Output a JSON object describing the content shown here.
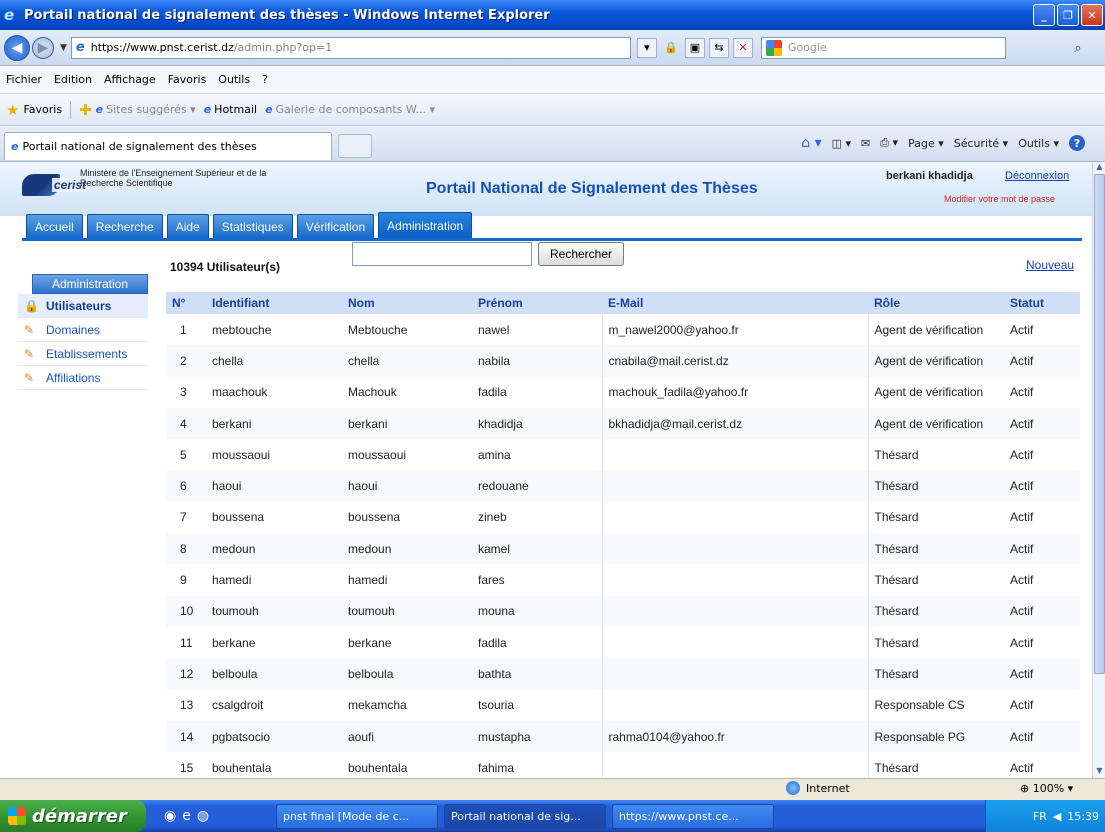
{
  "window": {
    "title": "Portail national de signalement des thèses - Windows Internet Explorer"
  },
  "address": {
    "url_host": "https://www.pnst.cerist.dz",
    "url_path": "/admin.php?op=1",
    "search_placeholder": "Google"
  },
  "menu": [
    "Fichier",
    "Edition",
    "Affichage",
    "Favoris",
    "Outils",
    "?"
  ],
  "favorites": {
    "label": "Favoris",
    "items": [
      "Sites suggérés ▾",
      "Hotmail",
      "Galerie de composants W... ▾"
    ]
  },
  "tab": {
    "title": "Portail national de signalement des thèses"
  },
  "commands": {
    "page": "Page ▾",
    "security": "Sécurité ▾",
    "tools": "Outils ▾"
  },
  "site": {
    "ministry": "Ministère de l'Enseignement Supérieur et de la Recherche Scientifique",
    "logo_word": "cerist",
    "title": "Portail National de Signalement des Thèses",
    "user": "berkani khadidja",
    "logout": "Déconnexion",
    "change_password": "Modifier votre mot de passe"
  },
  "nav": [
    "Accueil",
    "Recherche",
    "Aide",
    "Statistiques",
    "Vérification",
    "Administration"
  ],
  "sidebar": {
    "title": "Administration",
    "items": [
      "Utilisateurs",
      "Domaines",
      "Etablissements",
      "Affiliations"
    ]
  },
  "users": {
    "count_label": "10394 Utilisateur(s)",
    "search_button": "Rechercher",
    "new_link": "Nouveau",
    "columns": [
      "N°",
      "Identifiant",
      "Nom",
      "Prénom",
      "E-Mail",
      "Rôle",
      "Statut"
    ],
    "rows": [
      [
        "1",
        "mebtouche",
        "Mebtouche",
        "nawel",
        "m_nawel2000@yahoo.fr",
        "Agent de vérification",
        "Actif"
      ],
      [
        "2",
        "chella",
        "chella",
        "nabila",
        "cnabila@mail.cerist.dz",
        "Agent de vérification",
        "Actif"
      ],
      [
        "3",
        "maachouk",
        "Machouk",
        "fadila",
        "machouk_fadila@yahoo.fr",
        "Agent de vérification",
        "Actif"
      ],
      [
        "4",
        "berkani",
        "berkani",
        "khadidja",
        "bkhadidja@mail.cerist.dz",
        "Agent de vérification",
        "Actif"
      ],
      [
        "5",
        "moussaoui",
        "moussaoui",
        "amina",
        "",
        "Thésard",
        "Actif"
      ],
      [
        "6",
        "haoui",
        "haoui",
        "redouane",
        "",
        "Thésard",
        "Actif"
      ],
      [
        "7",
        "boussena",
        "boussena",
        "zineb",
        "",
        "Thésard",
        "Actif"
      ],
      [
        "8",
        "medoun",
        "medoun",
        "kamel",
        "",
        "Thésard",
        "Actif"
      ],
      [
        "9",
        "hamedi",
        "hamedi",
        "fares",
        "",
        "Thésard",
        "Actif"
      ],
      [
        "10",
        "toumouh",
        "toumouh",
        "mouna",
        "",
        "Thésard",
        "Actif"
      ],
      [
        "11",
        "berkane",
        "berkane",
        "fadila",
        "",
        "Thésard",
        "Actif"
      ],
      [
        "12",
        "belboula",
        "belboula",
        "bathta",
        "",
        "Thésard",
        "Actif"
      ],
      [
        "13",
        "csalgdroit",
        "mekamcha",
        "tsouria",
        "",
        "Responsable CS",
        "Actif"
      ],
      [
        "14",
        "pgbatsocio",
        "aoufi",
        "mustapha",
        "rahma0104@yahoo.fr",
        "Responsable PG",
        "Actif"
      ],
      [
        "15",
        "bouhentala",
        "bouhentala",
        "fahima",
        "",
        "Thésard",
        "Actif"
      ]
    ]
  },
  "statusbar": {
    "zone": "Internet",
    "zoom": "100%"
  },
  "taskbar": {
    "start": "démarrer",
    "tasks": [
      "pnst final [Mode de c...",
      "Portail national de sig...",
      "https://www.pnst.ce..."
    ],
    "lang": "FR",
    "time": "15:39"
  }
}
